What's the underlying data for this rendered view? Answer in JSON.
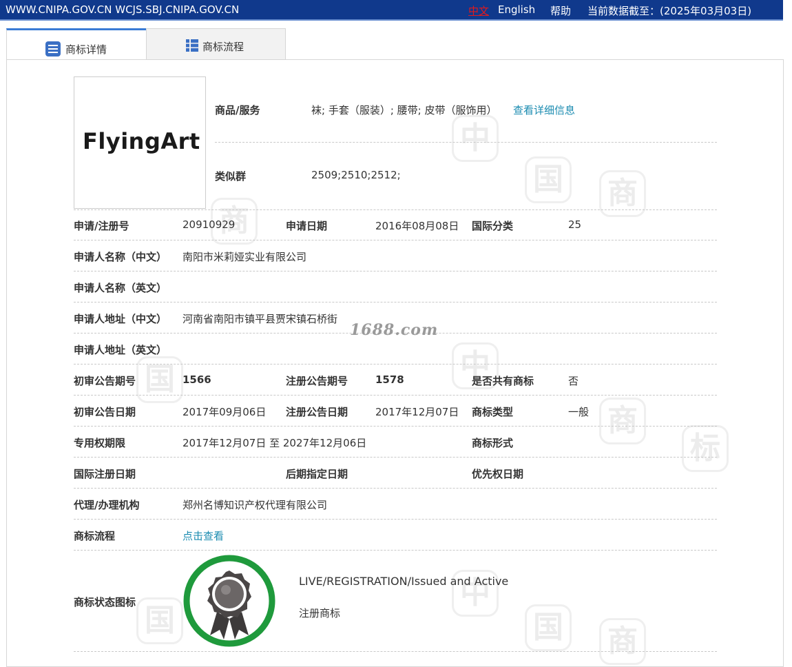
{
  "topbar": {
    "sites": "WWW.CNIPA.GOV.CN WCJS.SBJ.CNIPA.GOV.CN",
    "lang_zh": "中文",
    "lang_en": "English",
    "help": "帮助",
    "data_date": "当前数据截至：(2025年03月03日)"
  },
  "tabs": [
    {
      "label": "商标详情",
      "icon": "list-icon"
    },
    {
      "label": "商标流程",
      "icon": "table-icon"
    }
  ],
  "mark": {
    "logo_text": "FlyingArt",
    "goods_label": "商品/服务",
    "goods_value": "袜; 手套（服装）; 腰带; 皮带（服饰用）",
    "goods_link": "查看详细信息",
    "similar_label": "类似群",
    "similar_value": "2509;2510;2512;"
  },
  "rows": {
    "reg_no_label": "申请/注册号",
    "reg_no": "20910929",
    "apply_date_label": "申请日期",
    "apply_date": "2016年08月08日",
    "intl_class_label": "国际分类",
    "intl_class": "25",
    "applicant_cn_label": "申请人名称（中文）",
    "applicant_cn": "南阳市米莉娅实业有限公司",
    "applicant_en_label": "申请人名称（英文）",
    "address_cn_label": "申请人地址（中文）",
    "address_cn": "河南省南阳市镇平县贾宋镇石桥街",
    "address_en_label": "申请人地址（英文）",
    "prelim_no_label": "初审公告期号",
    "prelim_no": "1566",
    "reg_ann_no_label": "注册公告期号",
    "reg_ann_no": "1578",
    "shared_label": "是否共有商标",
    "shared": "否",
    "prelim_date_label": "初审公告日期",
    "prelim_date": "2017年09月06日",
    "reg_ann_date_label": "注册公告日期",
    "reg_ann_date": "2017年12月07日",
    "type_label": "商标类型",
    "type": "一般",
    "term_label": "专用权期限",
    "term": "2017年12月07日 至 2027年12月06日",
    "form_label": "商标形式",
    "intl_reg_label": "国际注册日期",
    "later_label": "后期指定日期",
    "priority_label": "优先权日期",
    "agent_label": "代理/办理机构",
    "agent": "郑州名博知识产权代理有限公司",
    "flow_label": "商标流程",
    "flow_link": "点击查看",
    "status_label": "商标状态图标",
    "status_en": "LIVE/REGISTRATION/Issued and Active",
    "status_cn": "注册商标"
  },
  "watermark": "1688.com",
  "colors": {
    "topbar": "#10398c",
    "link": "#1a8bb0",
    "badge_ring": "#1f9a3c"
  }
}
